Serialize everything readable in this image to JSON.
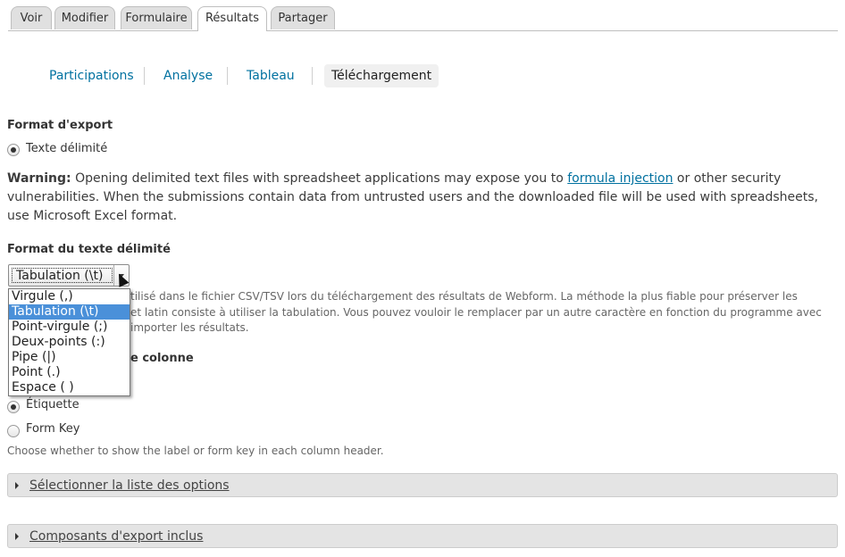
{
  "tabs": [
    {
      "label": "Voir"
    },
    {
      "label": "Modifier"
    },
    {
      "label": "Formulaire"
    },
    {
      "label": "Résultats",
      "active": true
    },
    {
      "label": "Partager"
    }
  ],
  "subtabs": [
    {
      "label": "Participations"
    },
    {
      "label": "Analyse"
    },
    {
      "label": "Tableau"
    },
    {
      "label": "Téléchargement",
      "active": true
    }
  ],
  "export_format": {
    "title": "Format d'export",
    "option": "Texte délimité",
    "selected": true
  },
  "warning": {
    "bold": "Warning:",
    "text_before": " Opening delimited text files with spreadsheet applications may expose you to ",
    "link": "formula injection",
    "text_after": " or other security vulnerabilities. When the submissions contain data from untrusted users and the downloaded file will be used with spreadsheets, use Microsoft Excel format."
  },
  "delimited_format": {
    "title": "Format du texte délimité",
    "selected_value": "Tabulation (\\t)",
    "options": [
      "Virgule (,)",
      "Tabulation (\\t)",
      "Point-virgule (;)",
      "Deux-points (:)",
      "Pipe (|)",
      "Point (.)",
      "Espace ( )"
    ],
    "selected_index": 1,
    "description_line1": "tilisé dans le fichier CSV/TSV lors du téléchargement des résultats de Webform. La méthode la plus fiable pour préserver les",
    "description_line2": "et latin consiste à utiliser la tabulation. Vous pouvez vouloir le remplacer par un autre caractère en fonction du programme avec",
    "description_line3": "importer les résultats."
  },
  "header_keys": {
    "title_partial": "e colonne",
    "options": [
      {
        "label": "Étiquette",
        "selected": true
      },
      {
        "label": "Form Key",
        "selected": false
      }
    ],
    "description": "Choose whether to show the label or form key in each column header."
  },
  "fieldsets": [
    {
      "label": "Sélectionner la liste des options"
    },
    {
      "label": "Composants d'export inclus"
    }
  ]
}
